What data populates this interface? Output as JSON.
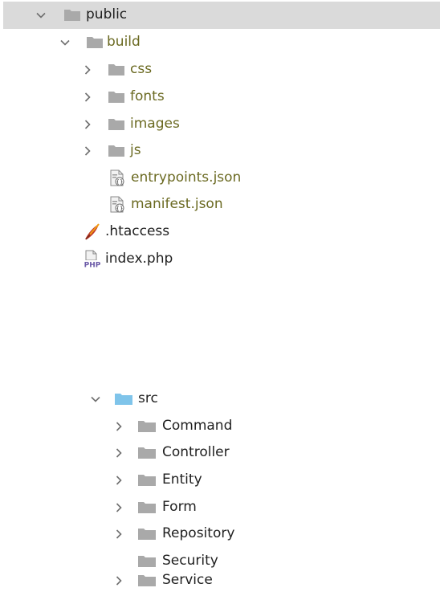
{
  "tree_top": {
    "root": {
      "label": "public",
      "expanded": true,
      "selected": true,
      "icon": "folder-icon"
    },
    "build": {
      "label": "build",
      "expanded": true,
      "icon": "folder-icon"
    },
    "build_children": [
      {
        "label": "css",
        "type": "folder",
        "expanded": false
      },
      {
        "label": "fonts",
        "type": "folder",
        "expanded": false
      },
      {
        "label": "images",
        "type": "folder",
        "expanded": false
      },
      {
        "label": "js",
        "type": "folder",
        "expanded": false
      },
      {
        "label": "entrypoints.json",
        "type": "json-file"
      },
      {
        "label": "manifest.json",
        "type": "json-file"
      }
    ],
    "files": [
      {
        "label": ".htaccess",
        "type": "htaccess-file"
      },
      {
        "label": "index.php",
        "type": "php-file"
      }
    ]
  },
  "tree_bottom": {
    "root": {
      "label": "src",
      "expanded": true,
      "icon": "source-folder-icon"
    },
    "children": [
      {
        "label": "Command",
        "has_children": true
      },
      {
        "label": "Controller",
        "has_children": true
      },
      {
        "label": "Entity",
        "has_children": true
      },
      {
        "label": "Form",
        "has_children": true
      },
      {
        "label": "Repository",
        "has_children": true
      },
      {
        "label": "Security",
        "has_children": false
      },
      {
        "label": "Service",
        "has_children": true
      }
    ]
  },
  "colors": {
    "selection": "#dadada",
    "folder": "#a9a9a9",
    "source_folder": "#7fc4ea",
    "untracked_text": "#6b6a22",
    "text": "#1f1f1f"
  }
}
